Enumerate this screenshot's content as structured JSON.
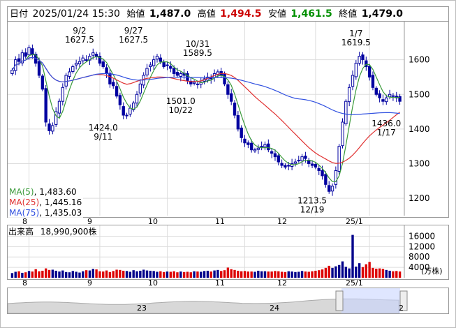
{
  "header": {
    "date_label": "日付",
    "datetime": "2025/01/24 15:30",
    "open_label": "始値",
    "open": "1,487.0",
    "high_label": "高値",
    "high": "1,494.5",
    "low_label": "安値",
    "low": "1,461.5",
    "close_label": "終値",
    "close": "1,479.0"
  },
  "colors": {
    "up": "#0000a0",
    "down": "#cc0000",
    "high": "#cc0000",
    "low": "#009000",
    "ma5": "#3a9a3a",
    "ma25": "#e03030",
    "ma75": "#3050e0",
    "volume_up": "#00008b",
    "volume_down": "#dd0000",
    "grid": "#dddddd",
    "nav_fill": "#d8d8d8"
  },
  "ma_legend": [
    {
      "label": "MA(5)",
      "value": "1,483.60",
      "key": "ma5"
    },
    {
      "label": "MA(25)",
      "value": "1,445.16",
      "key": "ma25"
    },
    {
      "label": "MA(75)",
      "value": "1,435.03",
      "key": "ma75"
    }
  ],
  "volume": {
    "title": "出来高",
    "value": "18,990,900株",
    "unit": "(万株)"
  },
  "chart_data": {
    "type": "candlestick",
    "x_month_labels": [
      "8",
      "9",
      "10",
      "11",
      "12",
      "25/1"
    ],
    "y_ticks": [
      1200,
      1300,
      1400,
      1500,
      1600
    ],
    "ylim": [
      1150,
      1710
    ],
    "annotations": [
      {
        "label": "9/2",
        "value": "1627.5",
        "kind": "high"
      },
      {
        "label": "9/11",
        "value": "1424.0",
        "kind": "low"
      },
      {
        "label": "9/27",
        "value": "1627.5",
        "kind": "high"
      },
      {
        "label": "10/22",
        "value": "1501.0",
        "kind": "low"
      },
      {
        "label": "10/31",
        "value": "1589.5",
        "kind": "high"
      },
      {
        "label": "12/19",
        "value": "1213.5",
        "kind": "low"
      },
      {
        "label": "1/7",
        "value": "1619.5",
        "kind": "high"
      },
      {
        "label": "1/17",
        "value": "1436.0",
        "kind": "low"
      }
    ],
    "closes": [
      1570,
      1600,
      1595,
      1620,
      1610,
      1635,
      1615,
      1590,
      1555,
      1515,
      1420,
      1395,
      1410,
      1450,
      1480,
      1520,
      1555,
      1565,
      1580,
      1590,
      1595,
      1605,
      1600,
      1610,
      1620,
      1610,
      1590,
      1580,
      1560,
      1530,
      1525,
      1495,
      1470,
      1440,
      1440,
      1460,
      1475,
      1500,
      1530,
      1555,
      1575,
      1585,
      1600,
      1610,
      1595,
      1580,
      1585,
      1575,
      1560,
      1555,
      1560,
      1555,
      1540,
      1530,
      1535,
      1530,
      1535,
      1545,
      1550,
      1545,
      1560,
      1565,
      1555,
      1530,
      1500,
      1480,
      1440,
      1400,
      1375,
      1360,
      1355,
      1340,
      1340,
      1345,
      1350,
      1355,
      1340,
      1330,
      1320,
      1305,
      1295,
      1290,
      1295,
      1300,
      1305,
      1310,
      1320,
      1315,
      1300,
      1295,
      1290,
      1280,
      1265,
      1240,
      1220,
      1235,
      1280,
      1350,
      1420,
      1480,
      1520,
      1555,
      1590,
      1610,
      1600,
      1580,
      1550,
      1520,
      1500,
      1490,
      1480,
      1490,
      1500,
      1495,
      1490,
      1480
    ],
    "volumes": [
      1800,
      2300,
      2500,
      1900,
      2100,
      2600,
      2400,
      3300,
      2500,
      2700,
      3600,
      3000,
      3100,
      2700,
      2400,
      2800,
      2200,
      2100,
      2600,
      2300,
      2000,
      2500,
      2900,
      2800,
      3400,
      3200,
      2500,
      2400,
      2800,
      2200,
      2600,
      3100,
      3000,
      2700,
      2600,
      2300,
      2900,
      2500,
      2700,
      3100,
      2800,
      2700,
      2600,
      2300,
      2500,
      2200,
      2400,
      2300,
      2500,
      2100,
      2400,
      2200,
      2300,
      2100,
      2500,
      2400,
      2300,
      2600,
      2700,
      2400,
      2800,
      3000,
      2600,
      2900,
      3900,
      3300,
      3000,
      2700,
      2500,
      2600,
      2400,
      2400,
      2300,
      2700,
      2500,
      2500,
      2400,
      2400,
      2600,
      2500,
      2300,
      2200,
      2500,
      2400,
      2200,
      2300,
      2600,
      2400,
      2300,
      2500,
      2700,
      2900,
      3200,
      3800,
      4600,
      3800,
      4400,
      4900,
      6300,
      4200,
      3600,
      16500,
      4300,
      5600,
      4100,
      5200,
      6100,
      3800,
      3500,
      3600,
      3400,
      3000,
      2700,
      2500,
      2600,
      2400
    ],
    "volume_y_ticks": [
      4000,
      8000,
      12000,
      16000
    ],
    "volume_max": 18000
  },
  "navigator": {
    "year_labels": [
      "23",
      "24",
      "2"
    ]
  }
}
